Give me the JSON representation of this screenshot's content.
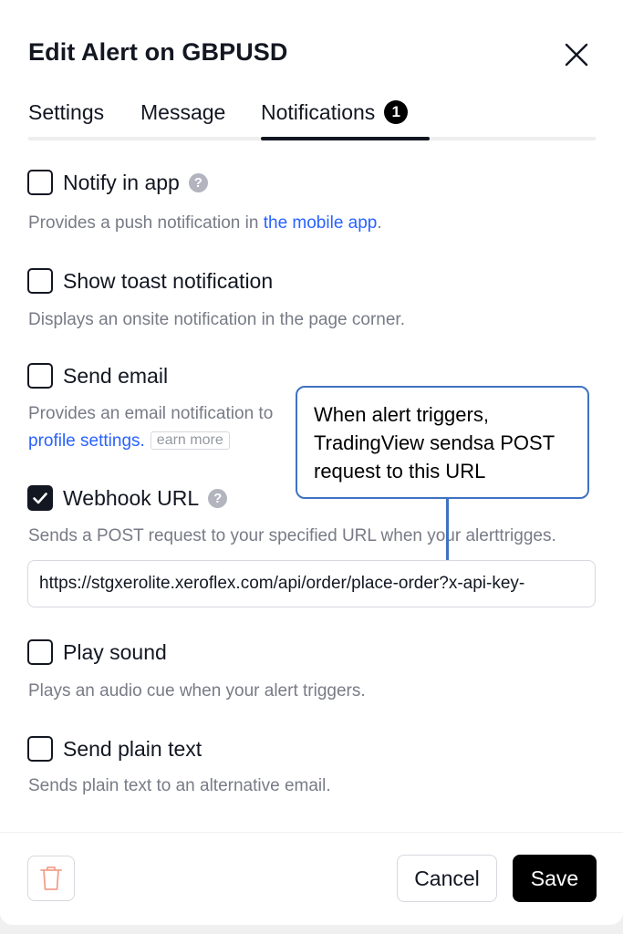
{
  "dialog": {
    "title": "Edit Alert on GBPUSD"
  },
  "tabs": [
    {
      "label": "Settings"
    },
    {
      "label": "Message"
    },
    {
      "label": "Notifications",
      "badge": "1",
      "active": true
    }
  ],
  "options": {
    "notify_in_app": {
      "label": "Notify in app",
      "checked": false,
      "help_glyph": "?",
      "desc_prefix": "Provides a push notification in ",
      "desc_link": "the mobile app",
      "desc_suffix": "."
    },
    "toast": {
      "label": "Show toast notification",
      "checked": false,
      "desc": "Displays an onsite notification in the page corner."
    },
    "email": {
      "label": "Send email",
      "checked": false,
      "desc_prefix": "Provides an email notification to",
      "desc_link": "profile settings.",
      "learn_more": "earn more"
    },
    "webhook": {
      "label": "Webhook URL",
      "checked": true,
      "help_glyph": "?",
      "desc": "Sends a POST request to your specified URL when your alerttrigges.",
      "url_value": "https://stgxerolite.xeroflex.com/api/order/place-order?x-api-key-"
    },
    "play_sound": {
      "label": "Play sound",
      "checked": false,
      "desc": "Plays an audio cue when your alert triggers."
    },
    "plain_text": {
      "label": "Send plain text",
      "checked": false,
      "desc": "Sends plain text to an alternative email."
    }
  },
  "callout": {
    "text": "When alert triggers, TradingView sendsa POST request to this URL"
  },
  "footer": {
    "cancel_label": "Cancel",
    "save_label": "Save"
  },
  "colors": {
    "accent_link": "#2962ff",
    "callout_border": "#3f72c3",
    "trash_icon": "#f2a08b",
    "primary_button": "#000000"
  },
  "icons": {
    "close": "close-icon",
    "trash": "trash-icon",
    "check": "checkmark-icon",
    "help": "question-circle-icon"
  }
}
